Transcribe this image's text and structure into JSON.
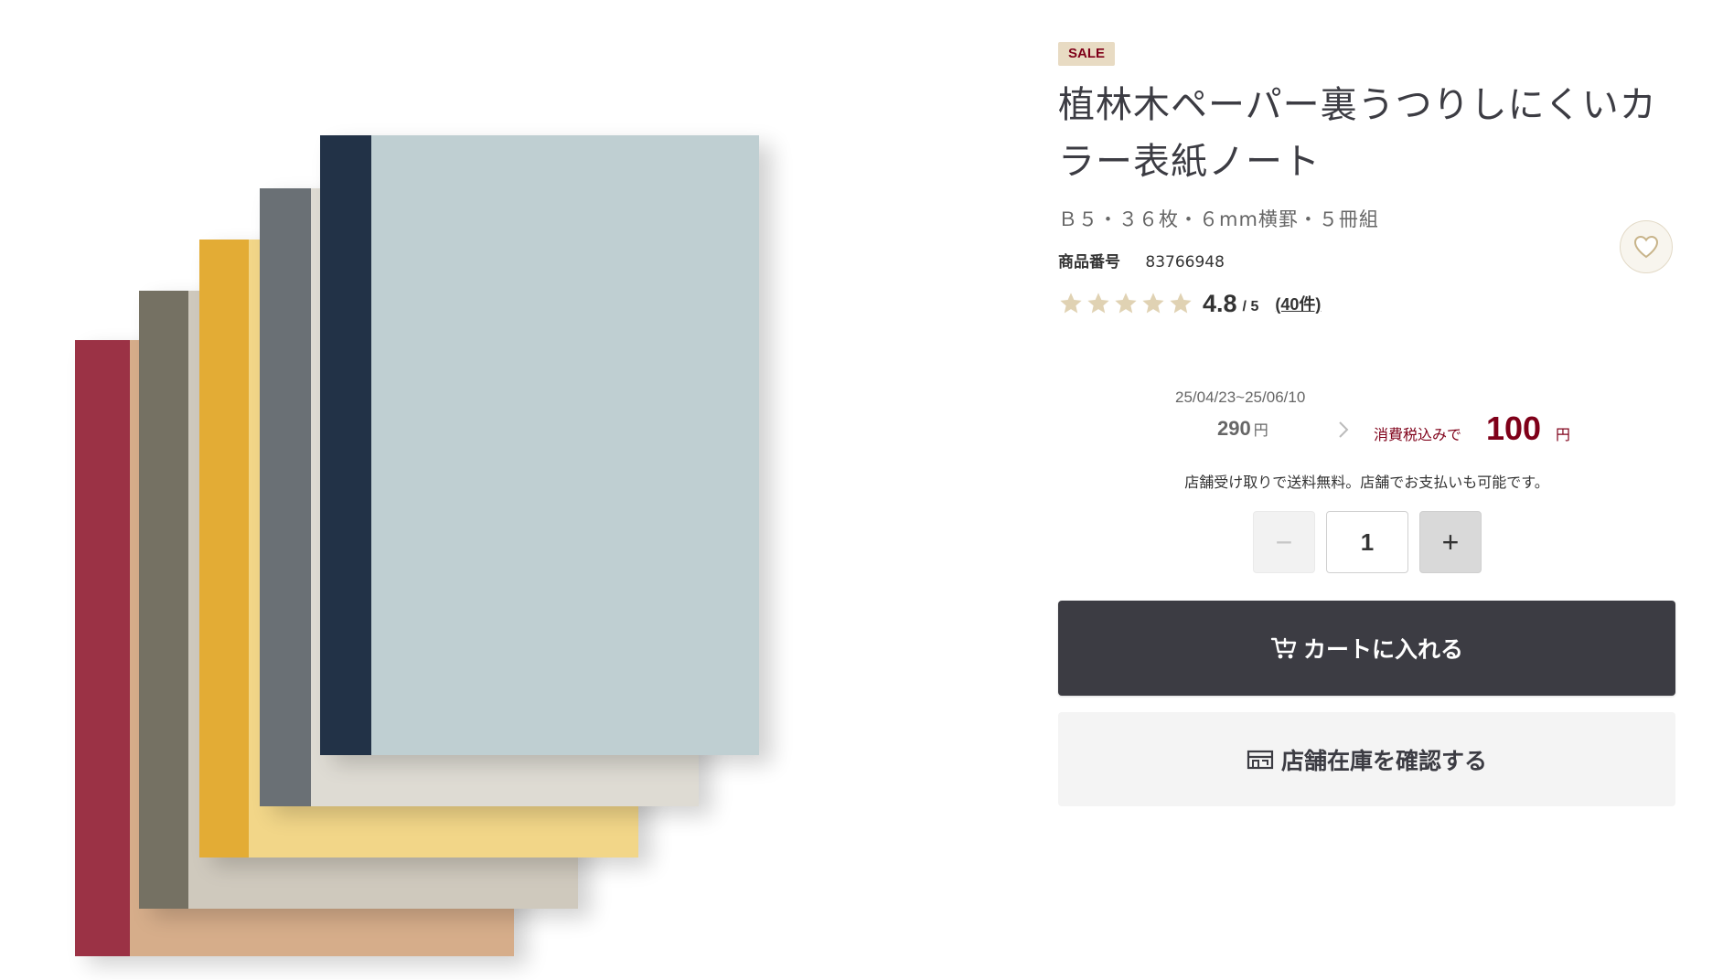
{
  "product": {
    "sale_badge": "SALE",
    "title": "植林木ペーパー裏うつりしにくいカラー表紙ノート",
    "spec": "Ｂ５・３６枚・６mm横罫・５冊組",
    "code_label": "商品番号",
    "code_value": "83766948",
    "image_alt": "カラー表紙ノート 5冊組",
    "cover_colors": [
      "#9b3344",
      "#747163",
      "#e3ac34",
      "#6b6f74",
      "#243246"
    ],
    "front_cover_color": "#bfcfd2"
  },
  "rating": {
    "value": "4.8",
    "max": "/ 5",
    "stars": 5,
    "star_color": "#e0d2b3",
    "review_count": "(40件)"
  },
  "price": {
    "sale_period": "25/04/23~25/06/10",
    "old_price": "290",
    "old_currency": "円",
    "tax_label": "消費税込みで",
    "new_price": "100",
    "new_currency": "円",
    "accent_color": "#7f0019"
  },
  "shipping_note": "店舗受け取りで送料無料。店舗でお支払いも可能です。",
  "quantity": {
    "minus_label": "−",
    "value": "1",
    "plus_label": "+"
  },
  "actions": {
    "cart_label": "カートに入れる",
    "store_label": "店舗在庫を確認する"
  }
}
